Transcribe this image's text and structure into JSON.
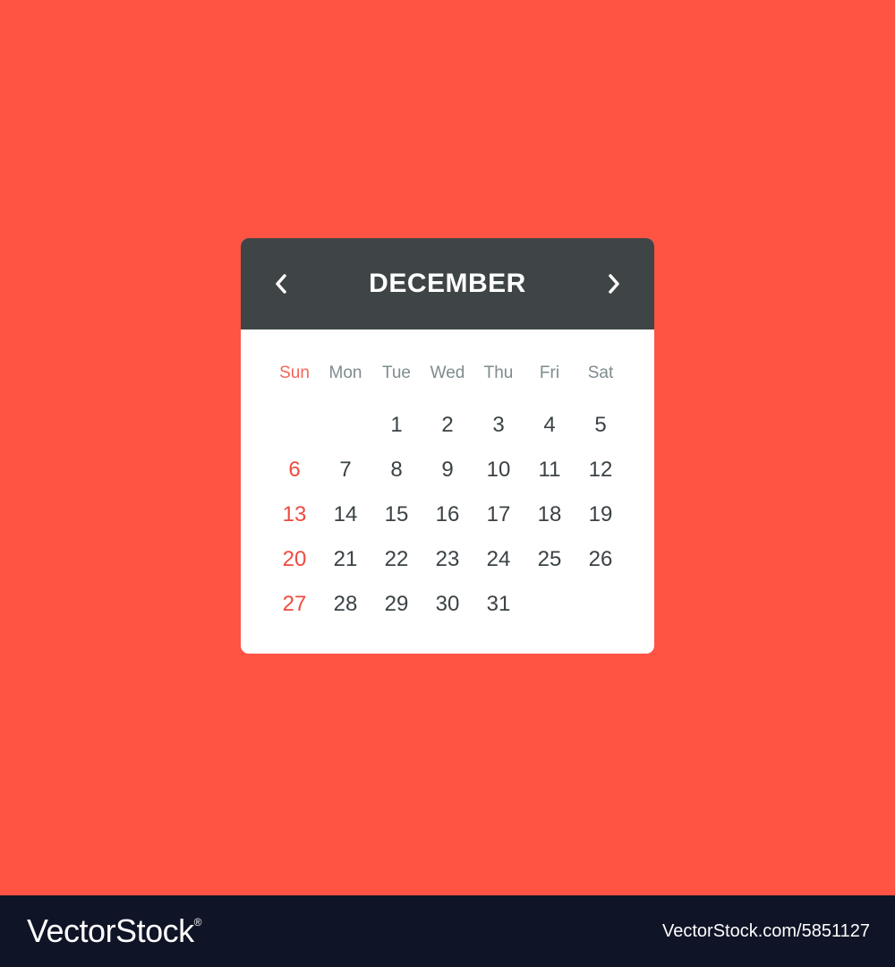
{
  "colors": {
    "background": "#FF5344",
    "header": "#3F4546",
    "card": "#FFFFFF",
    "weekday_text": "#7E8B8D",
    "sunday_weekday_text": "#F5655A",
    "sunday_date_text": "#EE4B3F",
    "date_text": "#3B4245",
    "footer": "#0F1426"
  },
  "calendar": {
    "month": "DECEMBER",
    "prev_icon": "chevron-left-icon",
    "next_icon": "chevron-right-icon",
    "weekdays": [
      "Sun",
      "Mon",
      "Tue",
      "Wed",
      "Thu",
      "Fri",
      "Sat"
    ],
    "weeks": [
      [
        "",
        "",
        "1",
        "2",
        "3",
        "4",
        "5"
      ],
      [
        "6",
        "7",
        "8",
        "9",
        "10",
        "11",
        "12"
      ],
      [
        "13",
        "14",
        "15",
        "16",
        "17",
        "18",
        "19"
      ],
      [
        "20",
        "21",
        "22",
        "23",
        "24",
        "25",
        "26"
      ],
      [
        "27",
        "28",
        "29",
        "30",
        "31",
        "",
        ""
      ]
    ]
  },
  "footer": {
    "brand": "VectorStock",
    "brand_mark": "®",
    "stock_id": "VectorStock.com/5851127"
  }
}
